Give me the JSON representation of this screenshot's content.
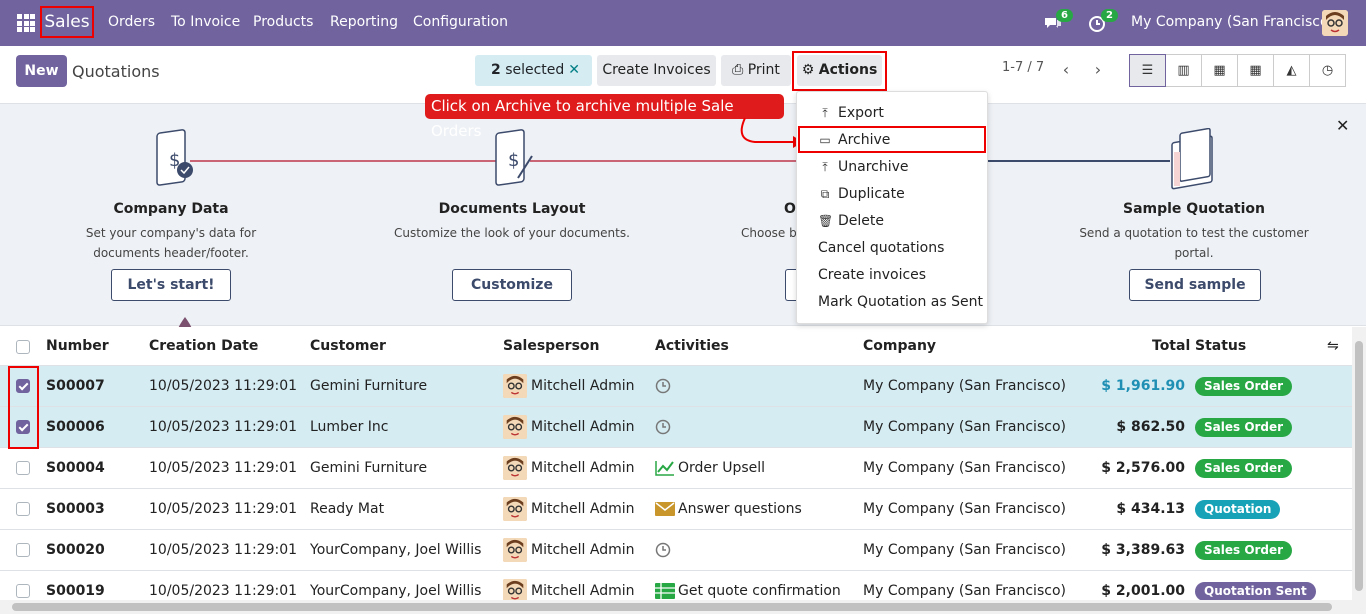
{
  "nav": {
    "brand": "Sales",
    "menu": [
      "Orders",
      "To Invoice",
      "Products",
      "Reporting",
      "Configuration"
    ],
    "chat_count": "6",
    "activity_count": "2",
    "company": "My Company (San Francisco)"
  },
  "control": {
    "new_label": "New",
    "title": "Quotations",
    "selected_count": "2",
    "selected_label": "selected",
    "create_invoices": "Create Invoices",
    "print": "Print",
    "actions": "Actions",
    "pager": "1-7 / 7"
  },
  "callout": "Click on Archive to archive multiple Sale Orders",
  "actions_menu": {
    "items": [
      "Export",
      "Archive",
      "Unarchive",
      "Duplicate",
      "Delete",
      "Cancel quotations",
      "Create invoices",
      "Mark Quotation as Sent"
    ]
  },
  "banner": {
    "steps": [
      {
        "title": "Company Data",
        "desc": "Set your company's data for documents header/footer.",
        "button": "Let's start!"
      },
      {
        "title": "Documents Layout",
        "desc": "Customize the look of your documents.",
        "button": "Customize"
      },
      {
        "title": "O",
        "desc": "Choose b",
        "button": ""
      },
      {
        "title": "Sample Quotation",
        "desc": "Send a quotation to test the customer portal.",
        "button": "Send sample"
      }
    ]
  },
  "table": {
    "headers": {
      "number": "Number",
      "date": "Creation Date",
      "customer": "Customer",
      "salesperson": "Salesperson",
      "activities": "Activities",
      "company": "Company",
      "total": "Total",
      "status": "Status"
    },
    "rows": [
      {
        "selected": true,
        "number": "S00007",
        "date": "10/05/2023 11:29:01",
        "customer": "Gemini Furniture",
        "salesperson": "Mitchell Admin",
        "activity": "",
        "activity_icon": "clock-icon",
        "company": "My Company (San Francisco)",
        "total": "$ 1,961.90",
        "status": "Sales Order",
        "status_color": "#28a745"
      },
      {
        "selected": true,
        "number": "S00006",
        "date": "10/05/2023 11:29:01",
        "customer": "Lumber Inc",
        "salesperson": "Mitchell Admin",
        "activity": "",
        "activity_icon": "clock-icon",
        "company": "My Company (San Francisco)",
        "total": "$ 862.50",
        "status": "Sales Order",
        "status_color": "#28a745"
      },
      {
        "selected": false,
        "number": "S00004",
        "date": "10/05/2023 11:29:01",
        "customer": "Gemini Furniture",
        "salesperson": "Mitchell Admin",
        "activity": "Order Upsell",
        "activity_icon": "chart-line-icon",
        "company": "My Company (San Francisco)",
        "total": "$ 2,576.00",
        "status": "Sales Order",
        "status_color": "#28a745"
      },
      {
        "selected": false,
        "number": "S00003",
        "date": "10/05/2023 11:29:01",
        "customer": "Ready Mat",
        "salesperson": "Mitchell Admin",
        "activity": "Answer questions",
        "activity_icon": "envelope-icon",
        "company": "My Company (San Francisco)",
        "total": "$ 434.13",
        "status": "Quotation",
        "status_color": "#17a2b8"
      },
      {
        "selected": false,
        "number": "S00020",
        "date": "10/05/2023 11:29:01",
        "customer": "YourCompany, Joel Willis",
        "salesperson": "Mitchell Admin",
        "activity": "",
        "activity_icon": "clock-icon",
        "company": "My Company (San Francisco)",
        "total": "$ 3,389.63",
        "status": "Sales Order",
        "status_color": "#28a745"
      },
      {
        "selected": false,
        "number": "S00019",
        "date": "10/05/2023 11:29:01",
        "customer": "YourCompany, Joel Willis",
        "salesperson": "Mitchell Admin",
        "activity": "Get quote confirmation",
        "activity_icon": "table-icon",
        "company": "My Company (San Francisco)",
        "total": "$ 2,001.00",
        "status": "Quotation Sent",
        "status_color": "#71639e"
      }
    ]
  }
}
